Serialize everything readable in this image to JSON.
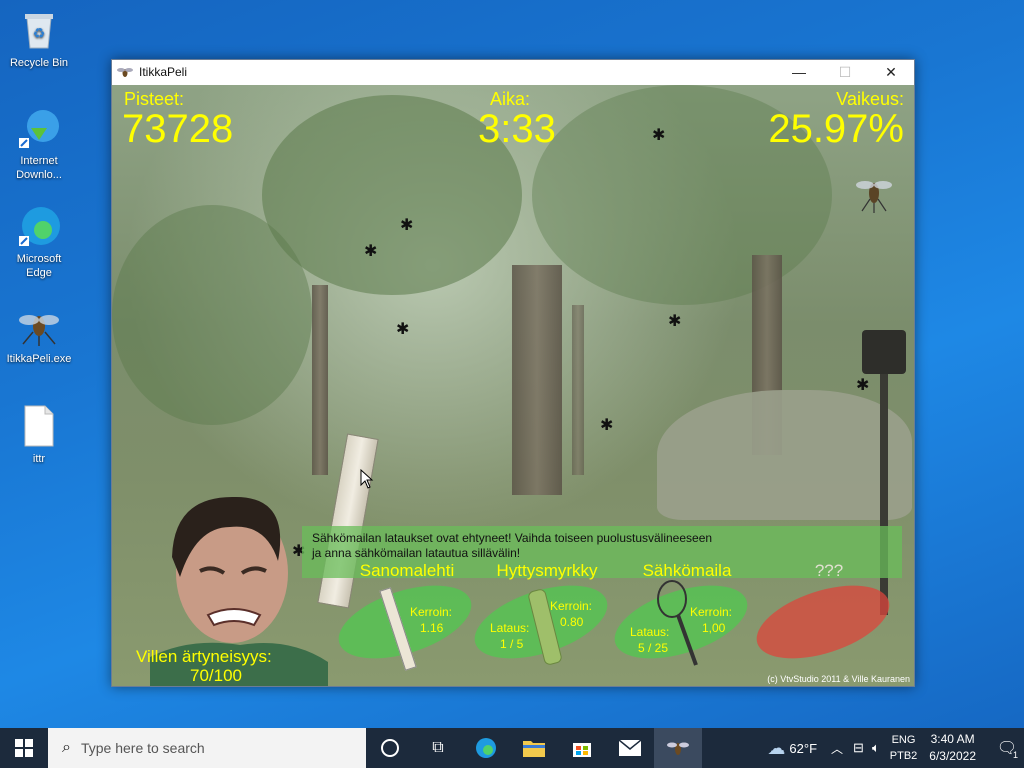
{
  "desktop": {
    "icons": [
      {
        "label": "Recycle Bin"
      },
      {
        "label": "Internet Downlo..."
      },
      {
        "label": "Microsoft Edge"
      },
      {
        "label": "ItikkaPeli.exe"
      },
      {
        "label": "ittr"
      }
    ]
  },
  "window": {
    "title": "ItikkaPeli",
    "controls": {
      "minimize": "—",
      "maximize": "☐",
      "close": "✕"
    }
  },
  "game": {
    "score_label": "Pisteet:",
    "score_value": "73728",
    "time_label": "Aika:",
    "time_value": "3:33",
    "difficulty_label": "Vaikeus:",
    "difficulty_value": "25.97%",
    "message_line1": "Sähkömailan lataukset ovat ehtyneet! Vaihda toiseen puolustusvälineeseen",
    "message_line2": "ja anna sähkömailan latautua sillävälin!",
    "irritation_label": "Villen ärtyneisyys:",
    "irritation_value": "70/100",
    "weapons": [
      {
        "name": "Sanomalehti",
        "kerroin_label": "Kerroin:",
        "kerroin_value": "1.16"
      },
      {
        "name": "Hyttysmyrkky",
        "kerroin_label": "Kerroin:",
        "kerroin_value": "0.80",
        "lataus_label": "Lataus:",
        "lataus_value": "1 / 5"
      },
      {
        "name": "Sähkömaila",
        "kerroin_label": "Kerroin:",
        "kerroin_value": "1,00",
        "lataus_label": "Lataus:",
        "lataus_value": "5 / 25"
      },
      {
        "name": "???"
      }
    ],
    "copyright": "(c) VtvStudio 2011 & Ville Kauranen",
    "mosquito_glyph": "✱"
  },
  "taskbar": {
    "search_placeholder": "Type here to search",
    "weather_temp": "62°F",
    "lang_top": "ENG",
    "lang_bottom": "PTB2",
    "time": "3:40 AM",
    "date": "6/3/2022",
    "notification_count": "1"
  }
}
